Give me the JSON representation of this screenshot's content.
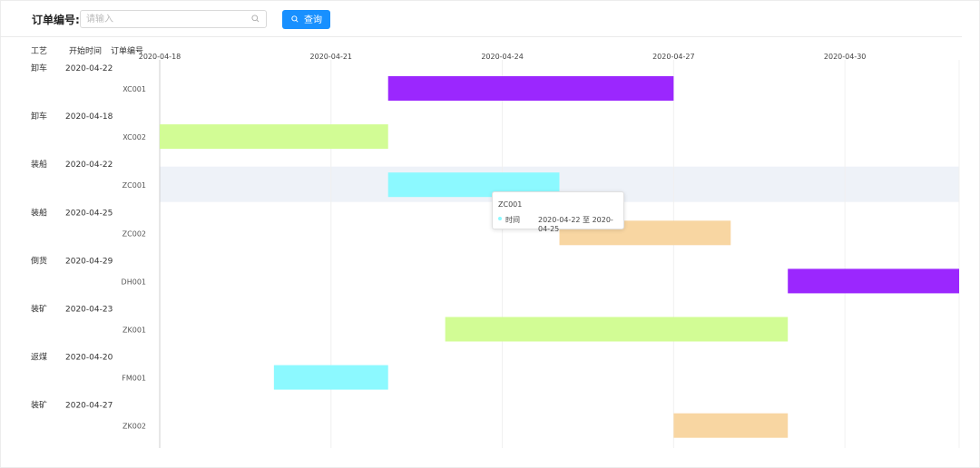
{
  "toolbar": {
    "order_label": "订单编号:",
    "search_placeholder": "请输入",
    "search_value": "",
    "query_label": "查询"
  },
  "tooltip": {
    "title": "ZC001",
    "series_label": "时间",
    "range_text": "2020-04-22 至 2020-04-25",
    "marker_color": "#8cf9ff"
  },
  "chart_data": {
    "type": "gantt",
    "columns": [
      "工艺",
      "开始时间",
      "订单编号"
    ],
    "x_ticks": [
      "2020-04-18",
      "2020-04-21",
      "2020-04-24",
      "2020-04-27",
      "2020-04-30"
    ],
    "x_range": [
      "2020-04-18",
      "2020-05-02"
    ],
    "highlighted_row": "ZC001",
    "rows": [
      {
        "process": "卸车",
        "start_label": "2020-04-22",
        "code": "XC001",
        "start": "2020-04-22",
        "end": "2020-04-27",
        "color": "#9b27fe"
      },
      {
        "process": "卸车",
        "start_label": "2020-04-18",
        "code": "XC002",
        "start": "2020-04-18",
        "end": "2020-04-22",
        "color": "#d2fc95"
      },
      {
        "process": "装船",
        "start_label": "2020-04-22",
        "code": "ZC001",
        "start": "2020-04-22",
        "end": "2020-04-25",
        "color": "#8cf9ff"
      },
      {
        "process": "装船",
        "start_label": "2020-04-25",
        "code": "ZC002",
        "start": "2020-04-25",
        "end": "2020-04-28",
        "color": "#f8d6a2"
      },
      {
        "process": "倒货",
        "start_label": "2020-04-29",
        "code": "DH001",
        "start": "2020-04-29",
        "end": "2020-05-02",
        "color": "#9b27fe"
      },
      {
        "process": "装矿",
        "start_label": "2020-04-23",
        "code": "ZK001",
        "start": "2020-04-23",
        "end": "2020-04-29",
        "color": "#d2fc95"
      },
      {
        "process": "返煤",
        "start_label": "2020-04-20",
        "code": "FM001",
        "start": "2020-04-20",
        "end": "2020-04-22",
        "color": "#8cf9ff"
      },
      {
        "process": "装矿",
        "start_label": "2020-04-27",
        "code": "ZK002",
        "start": "2020-04-27",
        "end": "2020-04-29",
        "color": "#f8d6a2"
      }
    ]
  }
}
